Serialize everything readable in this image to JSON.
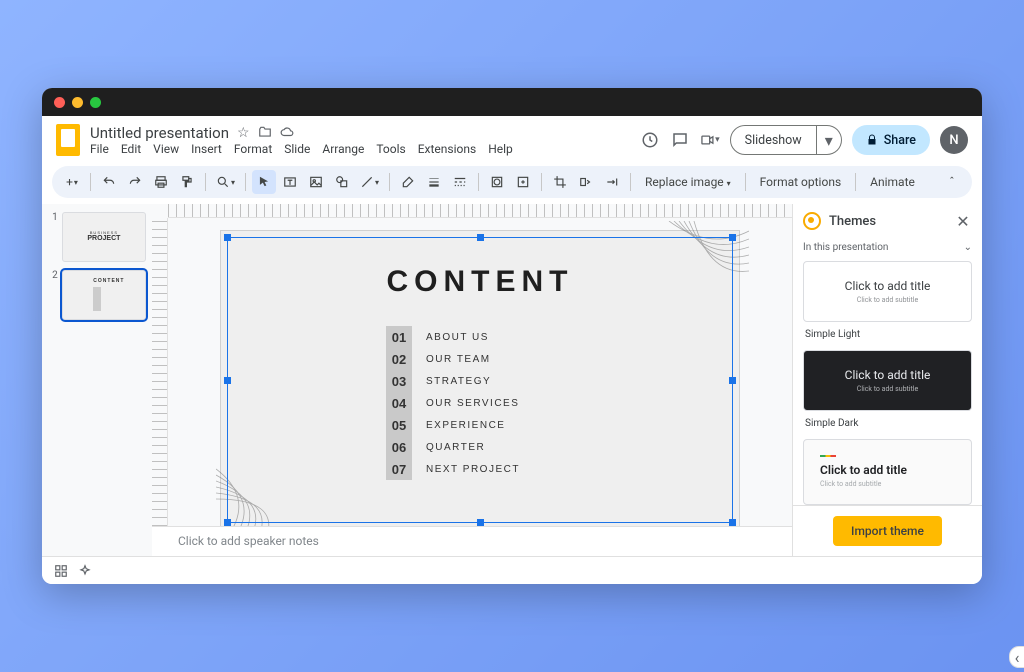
{
  "doc": {
    "title": "Untitled presentation"
  },
  "menus": [
    "File",
    "Edit",
    "View",
    "Insert",
    "Format",
    "Slide",
    "Arrange",
    "Tools",
    "Extensions",
    "Help"
  ],
  "header": {
    "slideshow": "Slideshow",
    "share": "Share",
    "avatar": "N"
  },
  "toolbar": {
    "replace_image": "Replace image",
    "format_options": "Format options",
    "animate": "Animate"
  },
  "thumbs": [
    {
      "num": "1",
      "line1": "BUSINESS",
      "line2": "PROJECT"
    },
    {
      "num": "2",
      "line1": "CONTENT"
    }
  ],
  "slide": {
    "title": "CONTENT",
    "items": [
      {
        "num": "01",
        "label": "ABOUT US"
      },
      {
        "num": "02",
        "label": "OUR TEAM"
      },
      {
        "num": "03",
        "label": "STRATEGY"
      },
      {
        "num": "04",
        "label": "OUR SERVICES"
      },
      {
        "num": "05",
        "label": "EXPERIENCE"
      },
      {
        "num": "06",
        "label": "QUARTER"
      },
      {
        "num": "07",
        "label": "NEXT PROJECT"
      }
    ]
  },
  "notes_placeholder": "Click to add speaker notes",
  "themes": {
    "panel_title": "Themes",
    "section": "In this presentation",
    "placeholder_title": "Click to add title",
    "placeholder_sub": "Click to add subtitle",
    "names": {
      "light": "Simple Light",
      "dark": "Simple Dark"
    },
    "import": "Import theme"
  }
}
